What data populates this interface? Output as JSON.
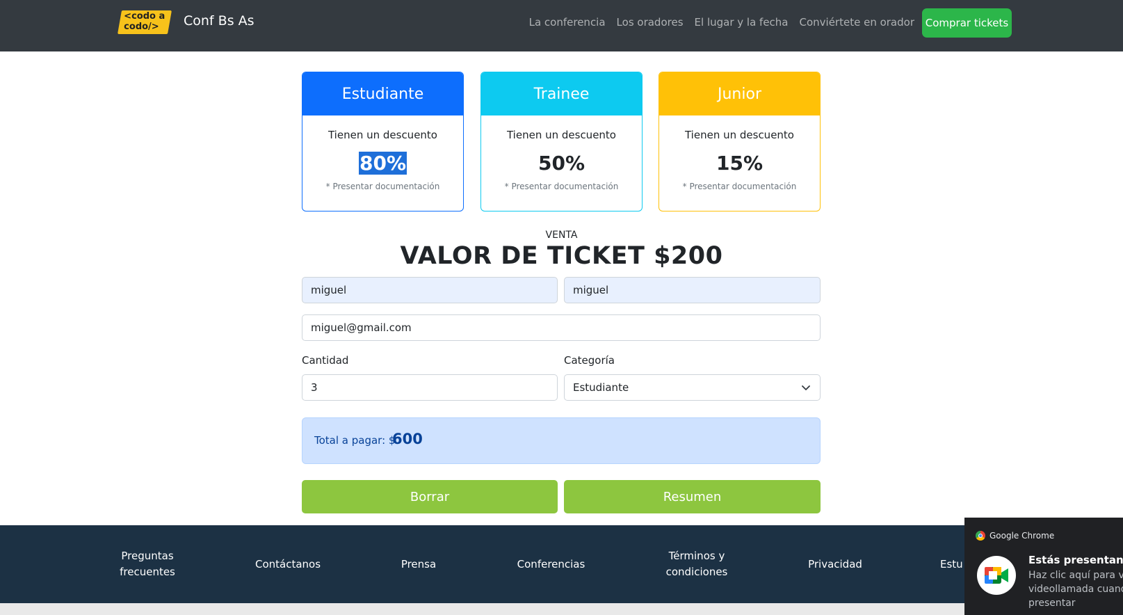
{
  "navbar": {
    "logo_line1": "<codo a",
    "logo_line2": "codo/>",
    "brand": "Conf Bs As",
    "links": [
      "La conferencia",
      "Los oradores",
      "El lugar y la fecha",
      "Conviértete en orador"
    ],
    "cta": "Comprar tickets"
  },
  "cards": [
    {
      "title": "Estudiante",
      "desc": "Tienen un descuento",
      "discount": "80%",
      "note": "* Presentar documentación",
      "color": "#0d6efd"
    },
    {
      "title": "Trainee",
      "desc": "Tienen un descuento",
      "discount": "50%",
      "note": "* Presentar documentación",
      "color": "#0dcaf0"
    },
    {
      "title": "Junior",
      "desc": "Tienen un descuento",
      "discount": "15%",
      "note": "* Presentar documentación",
      "color": "#ffc107"
    }
  ],
  "sale": {
    "kicker": "VENTA",
    "title": "VALOR DE TICKET $200"
  },
  "form": {
    "first_name": "miguel",
    "last_name": "miguel",
    "email": "miguel@gmail.com",
    "quantity_label": "Cantidad",
    "quantity": "3",
    "category_label": "Categoría",
    "category": "Estudiante",
    "total_label": "Total a pagar: $",
    "total_value": "600",
    "clear_button": "Borrar",
    "summary_button": "Resumen"
  },
  "footer": {
    "links": [
      "Preguntas frecuentes",
      "Contáctanos",
      "Prensa",
      "Conferencias",
      "Términos y condiciones",
      "Privacidad",
      "Estu"
    ]
  },
  "toast": {
    "app": "Google Chrome",
    "title": "Estás presentando p",
    "text": "Haz clic aquí para vo videollamada cuando presentar"
  }
}
